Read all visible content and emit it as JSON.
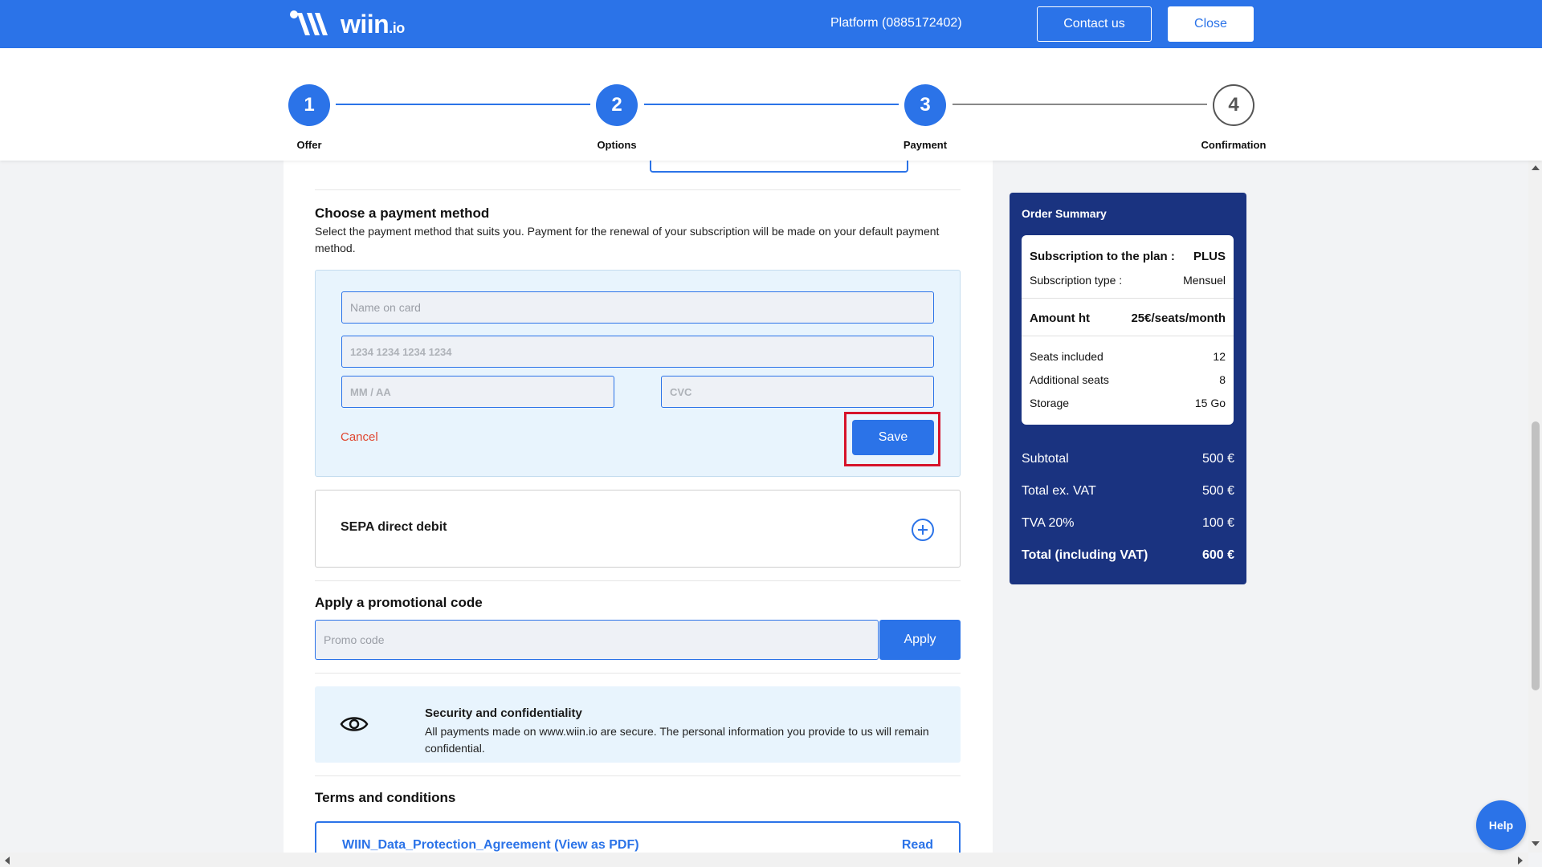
{
  "header": {
    "logo_text": "wiin",
    "logo_suffix": ".io",
    "platform": "Platform (0885172402)",
    "contact_label": "Contact us",
    "close_label": "Close"
  },
  "stepper": {
    "steps": [
      {
        "number": "1",
        "label": "Offer"
      },
      {
        "number": "2",
        "label": "Options"
      },
      {
        "number": "3",
        "label": "Payment"
      },
      {
        "number": "4",
        "label": "Confirmation"
      }
    ]
  },
  "payment": {
    "title": "Choose a payment method",
    "description": "Select the payment method that suits you. Payment for the renewal of your subscription will be made on your default payment method.",
    "card_form": {
      "name_placeholder": "Name on card",
      "number_placeholder": "1234 1234 1234 1234",
      "expiry_placeholder": "MM / AA",
      "cvc_placeholder": "CVC",
      "cancel_label": "Cancel",
      "save_label": "Save"
    },
    "sepa_label": "SEPA direct debit"
  },
  "promo": {
    "title": "Apply a promotional code",
    "placeholder": "Promo code",
    "apply_label": "Apply"
  },
  "security": {
    "title": "Security and confidentiality",
    "text": "All payments made on www.wiin.io are secure. The personal information you provide to us will remain confidential."
  },
  "terms": {
    "title": "Terms and conditions",
    "doc_link": "WIIN_Data_Protection_Agreement (View as PDF)",
    "read_label": "Read"
  },
  "summary": {
    "title": "Order Summary",
    "plan_label": "Subscription to the plan :",
    "plan_value": "PLUS",
    "type_label": "Subscription type :",
    "type_value": "Mensuel",
    "amount_label": "Amount ht",
    "amount_value": "25€/seats/month",
    "seats_label": "Seats included",
    "seats_value": "12",
    "additional_label": "Additional seats",
    "additional_value": "8",
    "storage_label": "Storage",
    "storage_value": "15 Go",
    "subtotal_label": "Subtotal",
    "subtotal_value": "500 €",
    "total_ex_label": "Total ex. VAT",
    "total_ex_value": "500 €",
    "tva_label": "TVA 20%",
    "tva_value": "100 €",
    "total_label": "Total (including VAT)",
    "total_value": "600 €"
  },
  "help_label": "Help",
  "colors": {
    "primary": "#2b73e8",
    "summary_bg": "#1a3380",
    "highlight": "#d6132b",
    "cancel": "#e0452f"
  }
}
